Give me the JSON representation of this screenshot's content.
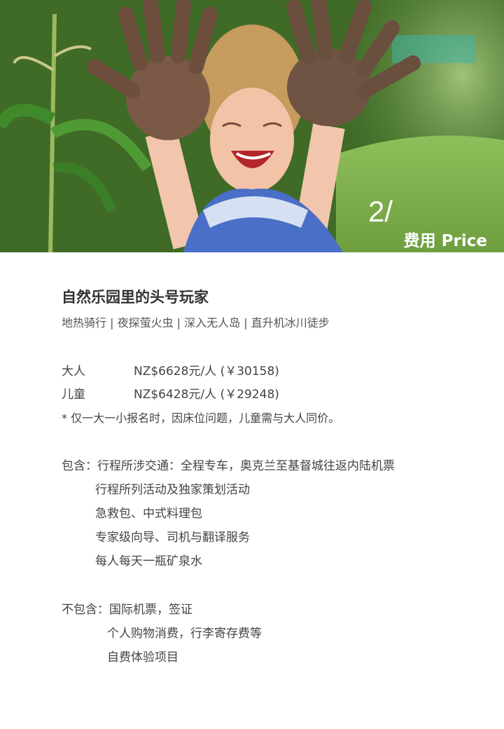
{
  "hero": {
    "section_number": "2/",
    "section_title": "费用 Price"
  },
  "trip": {
    "title": "自然乐园里的头号玩家",
    "subtitle": "地热骑行 | 夜探萤火虫 | 深入无人岛 | 直升机冰川徒步"
  },
  "prices": [
    {
      "label": "大人",
      "value": "NZ$6628元/人 (￥30158)"
    },
    {
      "label": "儿童",
      "value": "NZ$6428元/人 (￥29248)"
    }
  ],
  "price_note": "* 仅一大一小报名时，因床位问题，儿童需与大人同价。",
  "includes": {
    "label": "包含：",
    "items": [
      "行程所涉交通：全程专车，奥克兰至基督城往返内陆机票",
      "行程所列活动及独家策划活动",
      "急救包、中式料理包",
      "专家级向导、司机与翻译服务",
      "每人每天一瓶矿泉水"
    ]
  },
  "excludes": {
    "label": "不包含：",
    "items": [
      "国际机票，签证",
      "个人购物消费，行李寄存费等",
      "自费体验项目"
    ]
  }
}
